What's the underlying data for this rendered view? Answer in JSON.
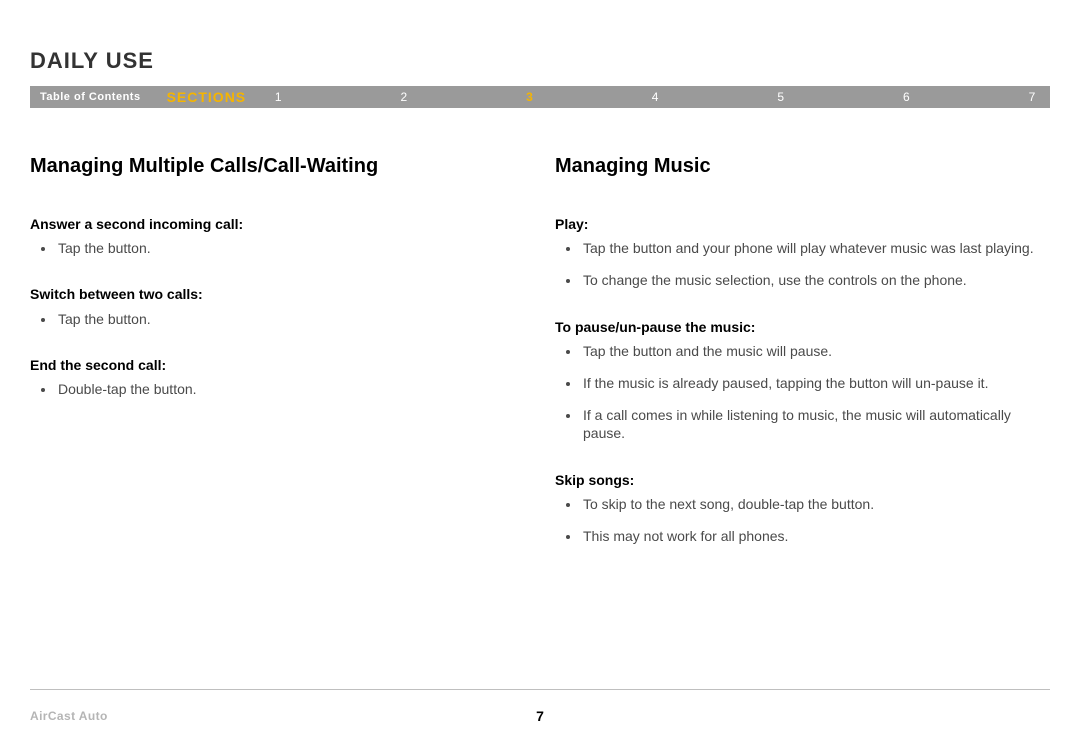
{
  "header": {
    "title": "DAILY USE"
  },
  "nav": {
    "toc": "Table of Contents",
    "sections_label": "SECTIONS",
    "numbers": [
      "1",
      "2",
      "3",
      "4",
      "5",
      "6",
      "7"
    ],
    "active_index": 2
  },
  "left": {
    "heading": "Managing Multiple Calls/Call-Waiting",
    "groups": [
      {
        "title": "Answer a second incoming call:",
        "items": [
          "Tap the button."
        ]
      },
      {
        "title": "Switch between two calls:",
        "items": [
          "Tap the button."
        ]
      },
      {
        "title": "End the second call:",
        "items": [
          "Double-tap the button."
        ]
      }
    ]
  },
  "right": {
    "heading": "Managing Music",
    "groups": [
      {
        "title": "Play:",
        "items": [
          "Tap the button and your phone will play whatever music was last playing.",
          "To change the music selection, use the controls on the phone."
        ]
      },
      {
        "title": "To pause/un-pause the music:",
        "items": [
          "Tap the button and the music will pause.",
          "If the music is already paused, tapping the button will un-pause it.",
          "If a call comes in while listening to music, the music will automatically pause."
        ]
      },
      {
        "title": "Skip songs:",
        "items": [
          "To skip to the next song, double-tap the button.",
          "This may not work for all phones."
        ]
      }
    ]
  },
  "footer": {
    "product": "AirCast Auto",
    "page_number": "7"
  }
}
